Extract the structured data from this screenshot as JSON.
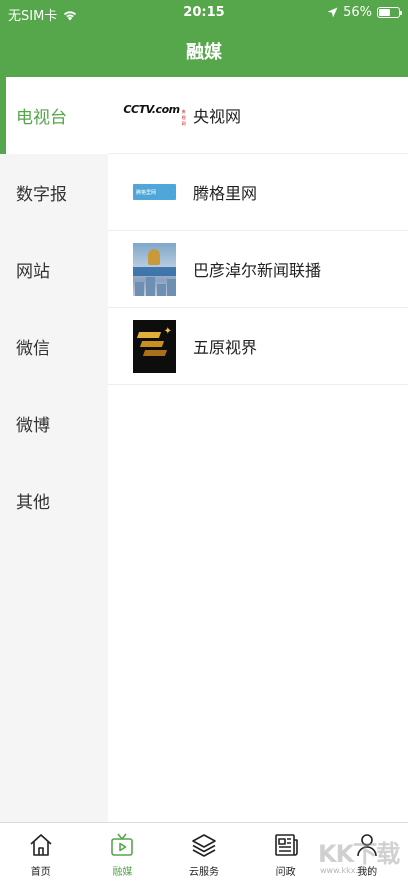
{
  "status_bar": {
    "carrier": "无SIM卡",
    "time": "20:15",
    "battery_text": "56%",
    "battery_level": 0.56
  },
  "nav": {
    "title": "融媒"
  },
  "sidebar": {
    "active_index": 0,
    "items": [
      {
        "label": "电视台"
      },
      {
        "label": "数字报"
      },
      {
        "label": "网站"
      },
      {
        "label": "微信"
      },
      {
        "label": "微博"
      },
      {
        "label": "其他"
      }
    ]
  },
  "list": {
    "items": [
      {
        "label": "央视网",
        "logo": "cctv-logo"
      },
      {
        "label": "腾格里网",
        "logo": "tenggeli-logo"
      },
      {
        "label": "巴彦淖尔新闻联播",
        "logo": "bayannur-news-logo"
      },
      {
        "label": "五原视界",
        "logo": "wuyuan-logo"
      }
    ],
    "cctv_logo_text": "CCTV.com",
    "cctv_logo_sub": "央视网",
    "tengge_logo_text": "腾格里网"
  },
  "tabbar": {
    "active_index": 1,
    "accent": "#56a64b",
    "items": [
      {
        "label": "首页",
        "icon": "home-icon"
      },
      {
        "label": "融媒",
        "icon": "tv-play-icon"
      },
      {
        "label": "云服务",
        "icon": "layers-icon"
      },
      {
        "label": "问政",
        "icon": "newspaper-icon"
      },
      {
        "label": "我的",
        "icon": "person-icon"
      }
    ]
  },
  "watermark": {
    "text": "KK下载",
    "url": "www.kkx.net"
  }
}
